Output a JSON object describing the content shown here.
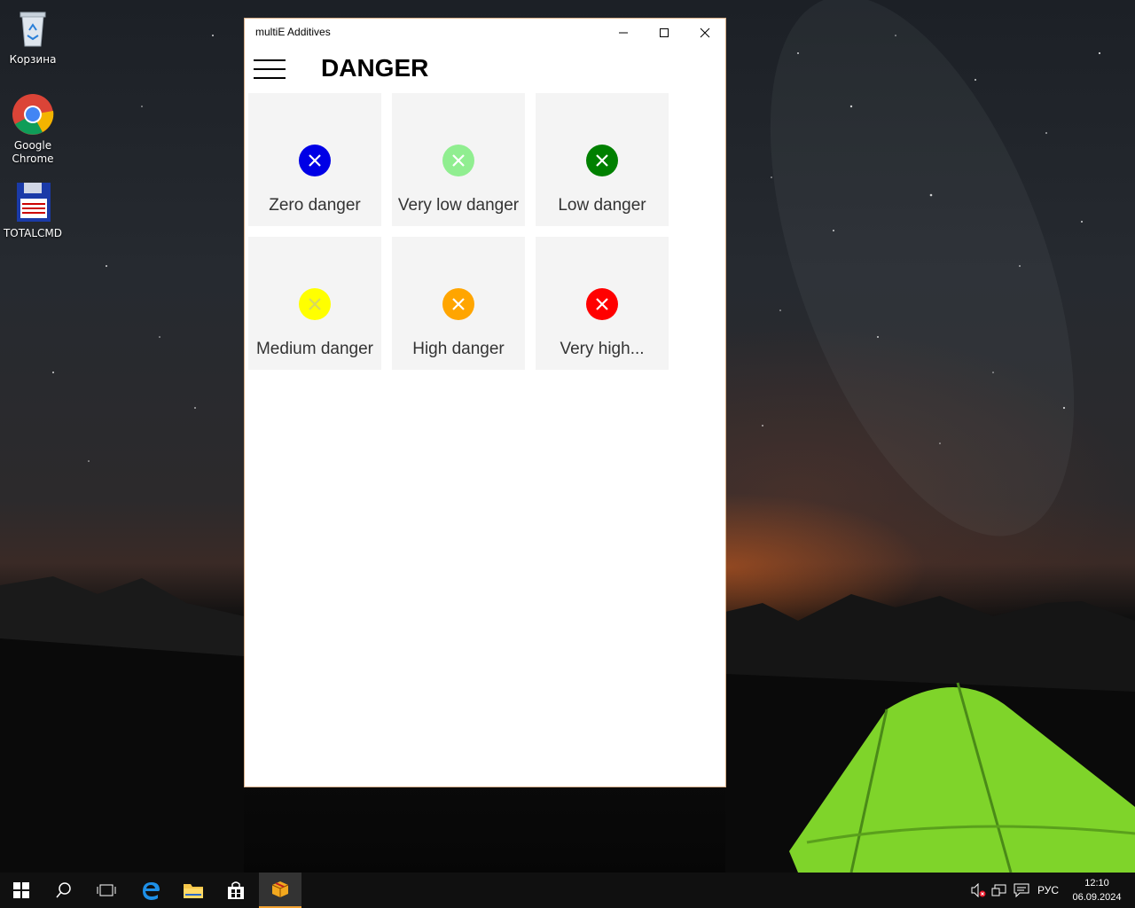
{
  "desktop": {
    "icons": [
      {
        "label": "Корзина"
      },
      {
        "label": "Google Chrome"
      },
      {
        "label": "TOTALCMD"
      }
    ]
  },
  "window": {
    "title": "multiE Additives",
    "page_title": "DANGER",
    "tiles": [
      {
        "label": "Zero danger",
        "color": "#0000e6"
      },
      {
        "label": "Very low danger",
        "color": "#90ee90"
      },
      {
        "label": "Low danger",
        "color": "#008000"
      },
      {
        "label": "Medium danger",
        "color": "#ffff00"
      },
      {
        "label": "High danger",
        "color": "#ffa500"
      },
      {
        "label": "Very high...",
        "color": "#ff0000"
      }
    ]
  },
  "taskbar": {
    "language": "РУС",
    "time": "12:10",
    "date": "06.09.2024"
  }
}
